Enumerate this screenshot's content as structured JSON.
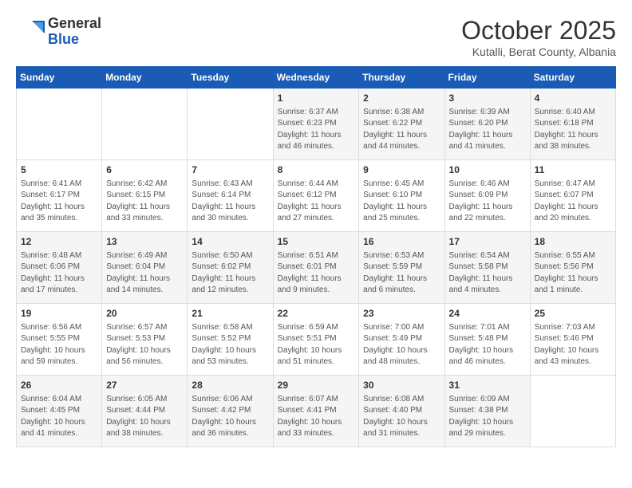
{
  "logo": {
    "general": "General",
    "blue": "Blue"
  },
  "header": {
    "month": "October 2025",
    "location": "Kutalli, Berat County, Albania"
  },
  "weekdays": [
    "Sunday",
    "Monday",
    "Tuesday",
    "Wednesday",
    "Thursday",
    "Friday",
    "Saturday"
  ],
  "weeks": [
    [
      {
        "day": null,
        "info": null
      },
      {
        "day": null,
        "info": null
      },
      {
        "day": null,
        "info": null
      },
      {
        "day": "1",
        "info": "Sunrise: 6:37 AM\nSunset: 6:23 PM\nDaylight: 11 hours\nand 46 minutes."
      },
      {
        "day": "2",
        "info": "Sunrise: 6:38 AM\nSunset: 6:22 PM\nDaylight: 11 hours\nand 44 minutes."
      },
      {
        "day": "3",
        "info": "Sunrise: 6:39 AM\nSunset: 6:20 PM\nDaylight: 11 hours\nand 41 minutes."
      },
      {
        "day": "4",
        "info": "Sunrise: 6:40 AM\nSunset: 6:18 PM\nDaylight: 11 hours\nand 38 minutes."
      }
    ],
    [
      {
        "day": "5",
        "info": "Sunrise: 6:41 AM\nSunset: 6:17 PM\nDaylight: 11 hours\nand 35 minutes."
      },
      {
        "day": "6",
        "info": "Sunrise: 6:42 AM\nSunset: 6:15 PM\nDaylight: 11 hours\nand 33 minutes."
      },
      {
        "day": "7",
        "info": "Sunrise: 6:43 AM\nSunset: 6:14 PM\nDaylight: 11 hours\nand 30 minutes."
      },
      {
        "day": "8",
        "info": "Sunrise: 6:44 AM\nSunset: 6:12 PM\nDaylight: 11 hours\nand 27 minutes."
      },
      {
        "day": "9",
        "info": "Sunrise: 6:45 AM\nSunset: 6:10 PM\nDaylight: 11 hours\nand 25 minutes."
      },
      {
        "day": "10",
        "info": "Sunrise: 6:46 AM\nSunset: 6:09 PM\nDaylight: 11 hours\nand 22 minutes."
      },
      {
        "day": "11",
        "info": "Sunrise: 6:47 AM\nSunset: 6:07 PM\nDaylight: 11 hours\nand 20 minutes."
      }
    ],
    [
      {
        "day": "12",
        "info": "Sunrise: 6:48 AM\nSunset: 6:06 PM\nDaylight: 11 hours\nand 17 minutes."
      },
      {
        "day": "13",
        "info": "Sunrise: 6:49 AM\nSunset: 6:04 PM\nDaylight: 11 hours\nand 14 minutes."
      },
      {
        "day": "14",
        "info": "Sunrise: 6:50 AM\nSunset: 6:02 PM\nDaylight: 11 hours\nand 12 minutes."
      },
      {
        "day": "15",
        "info": "Sunrise: 6:51 AM\nSunset: 6:01 PM\nDaylight: 11 hours\nand 9 minutes."
      },
      {
        "day": "16",
        "info": "Sunrise: 6:53 AM\nSunset: 5:59 PM\nDaylight: 11 hours\nand 6 minutes."
      },
      {
        "day": "17",
        "info": "Sunrise: 6:54 AM\nSunset: 5:58 PM\nDaylight: 11 hours\nand 4 minutes."
      },
      {
        "day": "18",
        "info": "Sunrise: 6:55 AM\nSunset: 5:56 PM\nDaylight: 11 hours\nand 1 minute."
      }
    ],
    [
      {
        "day": "19",
        "info": "Sunrise: 6:56 AM\nSunset: 5:55 PM\nDaylight: 10 hours\nand 59 minutes."
      },
      {
        "day": "20",
        "info": "Sunrise: 6:57 AM\nSunset: 5:53 PM\nDaylight: 10 hours\nand 56 minutes."
      },
      {
        "day": "21",
        "info": "Sunrise: 6:58 AM\nSunset: 5:52 PM\nDaylight: 10 hours\nand 53 minutes."
      },
      {
        "day": "22",
        "info": "Sunrise: 6:59 AM\nSunset: 5:51 PM\nDaylight: 10 hours\nand 51 minutes."
      },
      {
        "day": "23",
        "info": "Sunrise: 7:00 AM\nSunset: 5:49 PM\nDaylight: 10 hours\nand 48 minutes."
      },
      {
        "day": "24",
        "info": "Sunrise: 7:01 AM\nSunset: 5:48 PM\nDaylight: 10 hours\nand 46 minutes."
      },
      {
        "day": "25",
        "info": "Sunrise: 7:03 AM\nSunset: 5:46 PM\nDaylight: 10 hours\nand 43 minutes."
      }
    ],
    [
      {
        "day": "26",
        "info": "Sunrise: 6:04 AM\nSunset: 4:45 PM\nDaylight: 10 hours\nand 41 minutes."
      },
      {
        "day": "27",
        "info": "Sunrise: 6:05 AM\nSunset: 4:44 PM\nDaylight: 10 hours\nand 38 minutes."
      },
      {
        "day": "28",
        "info": "Sunrise: 6:06 AM\nSunset: 4:42 PM\nDaylight: 10 hours\nand 36 minutes."
      },
      {
        "day": "29",
        "info": "Sunrise: 6:07 AM\nSunset: 4:41 PM\nDaylight: 10 hours\nand 33 minutes."
      },
      {
        "day": "30",
        "info": "Sunrise: 6:08 AM\nSunset: 4:40 PM\nDaylight: 10 hours\nand 31 minutes."
      },
      {
        "day": "31",
        "info": "Sunrise: 6:09 AM\nSunset: 4:38 PM\nDaylight: 10 hours\nand 29 minutes."
      },
      {
        "day": null,
        "info": null
      }
    ]
  ]
}
